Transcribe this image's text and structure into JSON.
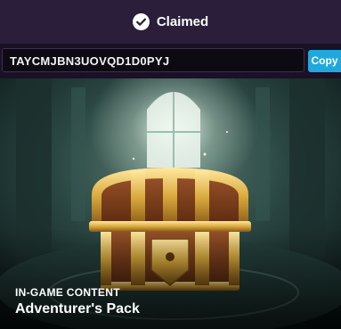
{
  "status": {
    "text": "Claimed",
    "icon": "checkmark-circle-icon"
  },
  "code": {
    "value": "TAYCMJBN3UOVQD1D0PYJ",
    "copy_label": "Copy"
  },
  "item": {
    "kicker": "IN-GAME CONTENT",
    "title": "Adventurer's Pack",
    "image_icon": "treasure-chest-icon"
  },
  "colors": {
    "header_bg": "#2a1e3a",
    "page_bg": "#1a1127",
    "accent": "#20a8dc"
  }
}
